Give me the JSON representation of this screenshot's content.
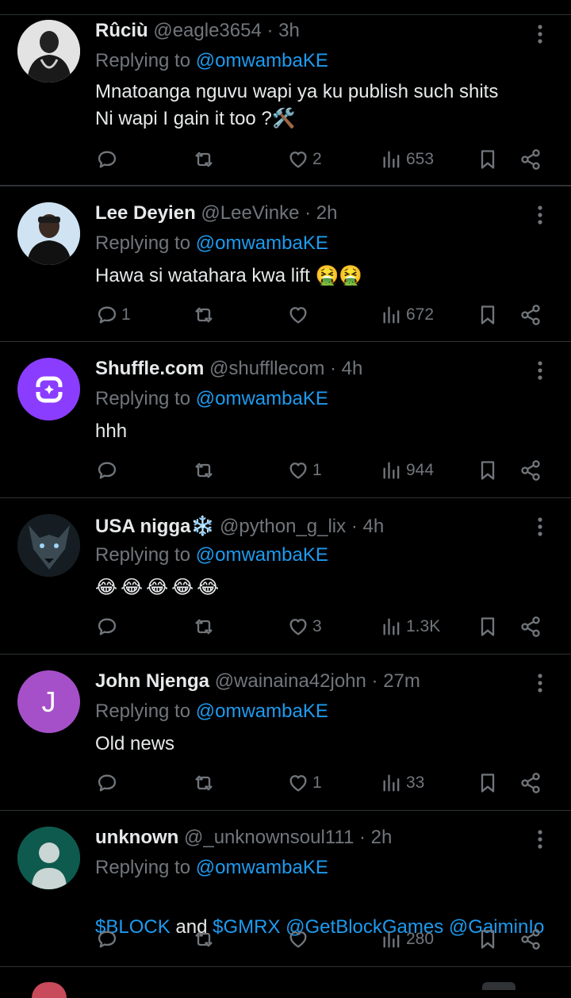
{
  "replies": [
    {
      "display_name": "Rûciù",
      "handle": "@eagle3654",
      "time": "· 3h",
      "replying_label": "Replying to",
      "replying_handle": "@omwambaKE",
      "text": "Mnatoanga nguvu wapi ya ku publish such shits\nNi wapi I gain it too ?🛠️",
      "reply_count": "",
      "retweet_count": "",
      "like_count": "2",
      "view_count": "653",
      "avatar_color": "#d9d9d9"
    },
    {
      "display_name": "Lee Deyien",
      "handle": "@LeeVinke",
      "time": "· 2h",
      "replying_label": "Replying to",
      "replying_handle": "@omwambaKE",
      "text": "Hawa si watahara kwa lift 🤮🤮",
      "reply_count": "1",
      "retweet_count": "",
      "like_count": "",
      "view_count": "672",
      "avatar_color": "#9fc6e0"
    },
    {
      "display_name": "Shuffle.com",
      "handle": "@shuffllecom",
      "time": "· 4h",
      "replying_label": "Replying to",
      "replying_handle": "@omwambaKE",
      "text": "hhh",
      "reply_count": "",
      "retweet_count": "",
      "like_count": "1",
      "view_count": "944",
      "avatar_color": "#8b3dff"
    },
    {
      "display_name": "USA nigga❄️",
      "handle": "@python_g_lix",
      "time": "· 4h",
      "replying_label": "Replying to",
      "replying_handle": "@omwambaKE",
      "text": "😂😂😂😂😂",
      "reply_count": "",
      "retweet_count": "",
      "like_count": "3",
      "view_count": "1.3K",
      "avatar_color": "#1c2a33"
    },
    {
      "display_name": "John Njenga",
      "handle": "@wainaina42john",
      "time": "· 27m",
      "replying_label": "Replying to",
      "replying_handle": "@omwambaKE",
      "text": "Old news",
      "avatar_letter": "J",
      "reply_count": "",
      "retweet_count": "",
      "like_count": "1",
      "view_count": "33",
      "avatar_color": "#a550c8"
    },
    {
      "display_name": "unknown",
      "handle": "@_unknownsoul111",
      "time": "· 2h",
      "replying_label": "Replying to",
      "replying_handle": "@omwambaKE",
      "text_parts": [
        "$BLOCK",
        " and ",
        "$GMRX",
        " ",
        "@GetBlockGames",
        " ",
        "@GaiminIo"
      ],
      "reply_count": "",
      "retweet_count": "",
      "like_count": "",
      "view_count": "280",
      "avatar_color": "#0e5a4e"
    }
  ],
  "colors": {
    "background": "#000000",
    "link": "#1d9bf0",
    "muted": "#71767b",
    "divider": "#2f3336"
  },
  "icons": [
    "reply-icon",
    "retweet-icon",
    "like-icon",
    "views-icon",
    "bookmark-icon",
    "share-icon",
    "more-icon"
  ]
}
